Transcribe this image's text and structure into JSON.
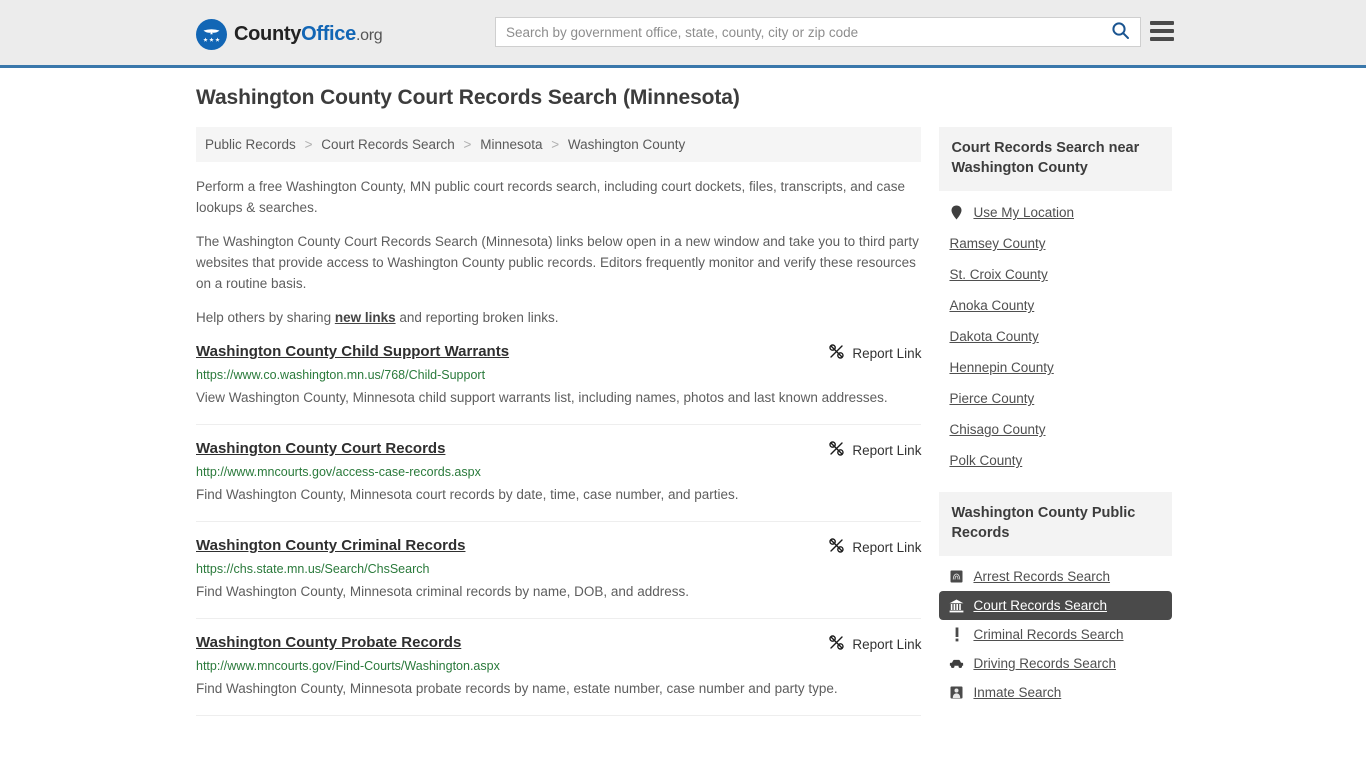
{
  "header": {
    "logo": {
      "part1": "County",
      "part2": "Office",
      "part3": ".org"
    },
    "search": {
      "placeholder": "Search by government office, state, county, city or zip code",
      "value": ""
    }
  },
  "page_title": "Washington County Court Records Search (Minnesota)",
  "breadcrumb": [
    "Public Records",
    "Court Records Search",
    "Minnesota",
    "Washington County"
  ],
  "breadcrumb_separator": ">",
  "intro": {
    "p1": "Perform a free Washington County, MN public court records search, including court dockets, files, transcripts, and case lookups & searches.",
    "p2": "The Washington County Court Records Search (Minnesota) links below open in a new window and take you to third party websites that provide access to Washington County public records. Editors frequently monitor and verify these resources on a routine basis.",
    "p3_before": "Help others by sharing ",
    "p3_link": "new links",
    "p3_after": " and reporting broken links."
  },
  "report_link_label": "Report Link",
  "results": [
    {
      "title": "Washington County Child Support Warrants",
      "url": "https://www.co.washington.mn.us/768/Child-Support",
      "description": "View Washington County, Minnesota child support warrants list, including names, photos and last known addresses."
    },
    {
      "title": "Washington County Court Records",
      "url": "http://www.mncourts.gov/access-case-records.aspx",
      "description": "Find Washington County, Minnesota court records by date, time, case number, and parties."
    },
    {
      "title": "Washington County Criminal Records",
      "url": "https://chs.state.mn.us/Search/ChsSearch",
      "description": "Find Washington County, Minnesota criminal records by name, DOB, and address."
    },
    {
      "title": "Washington County Probate Records",
      "url": "http://www.mncourts.gov/Find-Courts/Washington.aspx",
      "description": "Find Washington County, Minnesota probate records by name, estate number, case number and party type."
    }
  ],
  "sidebar": {
    "nearby": {
      "heading": "Court Records Search near Washington County",
      "use_my_location": "Use My Location",
      "counties": [
        "Ramsey County",
        "St. Croix County",
        "Anoka County",
        "Dakota County",
        "Hennepin County",
        "Pierce County",
        "Chisago County",
        "Polk County"
      ]
    },
    "public_records": {
      "heading": "Washington County Public Records",
      "items": [
        {
          "label": "Arrest Records Search",
          "icon": "fingerprint-icon",
          "active": false
        },
        {
          "label": "Court Records Search",
          "icon": "courthouse-icon",
          "active": true
        },
        {
          "label": "Criminal Records Search",
          "icon": "exclamation-icon",
          "active": false
        },
        {
          "label": "Driving Records Search",
          "icon": "car-icon",
          "active": false
        },
        {
          "label": "Inmate Search",
          "icon": "inmate-icon",
          "active": false
        }
      ]
    }
  },
  "colors": {
    "header_bg": "#ececec",
    "header_border": "#3a78ab",
    "brand_blue": "#1266b5",
    "link_green": "#2a7a3b",
    "active_bg": "#4a4a4a",
    "panel_bg": "#f3f3f3"
  }
}
